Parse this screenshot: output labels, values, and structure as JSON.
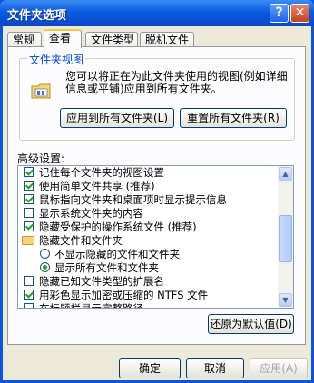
{
  "window": {
    "title": "文件夹选项",
    "help_label": "?",
    "close_label": "✕"
  },
  "tabs": [
    {
      "label": "常规"
    },
    {
      "label": "查看"
    },
    {
      "label": "文件类型"
    },
    {
      "label": "脱机文件"
    }
  ],
  "folder_views": {
    "title": "文件夹视图",
    "description": "您可以将正在为此文件夹使用的视图(例如详细信息或平铺)应用到所有文件夹。",
    "apply_all_label": "应用到所有文件夹(L)",
    "reset_all_label": "重置所有文件夹(R)"
  },
  "advanced": {
    "label": "高级设置:",
    "items": [
      {
        "type": "checkbox",
        "checked": true,
        "text": "记住每个文件夹的视图设置"
      },
      {
        "type": "checkbox",
        "checked": true,
        "text": "使用简单文件共享 (推荐)"
      },
      {
        "type": "checkbox",
        "checked": true,
        "text": "鼠标指向文件夹和桌面项时显示提示信息"
      },
      {
        "type": "checkbox",
        "checked": false,
        "text": "显示系统文件夹的内容"
      },
      {
        "type": "checkbox",
        "checked": true,
        "text": "隐藏受保护的操作系统文件 (推荐)"
      },
      {
        "type": "folder",
        "text": "隐藏文件和文件夹"
      },
      {
        "type": "radio",
        "checked": false,
        "text": "不显示隐藏的文件和文件夹"
      },
      {
        "type": "radio",
        "checked": true,
        "text": "显示所有文件和文件夹"
      },
      {
        "type": "checkbox",
        "checked": false,
        "text": "隐藏已知文件类型的扩展名"
      },
      {
        "type": "checkbox",
        "checked": true,
        "text": "用彩色显示加密或压缩的 NTFS 文件"
      },
      {
        "type": "checkbox",
        "checked": false,
        "text": "在标题栏显示完整路径"
      }
    ],
    "restore_label": "还原为默认值(D)"
  },
  "footer": {
    "ok_label": "确定",
    "cancel_label": "取消",
    "apply_label": "应用(A)"
  }
}
